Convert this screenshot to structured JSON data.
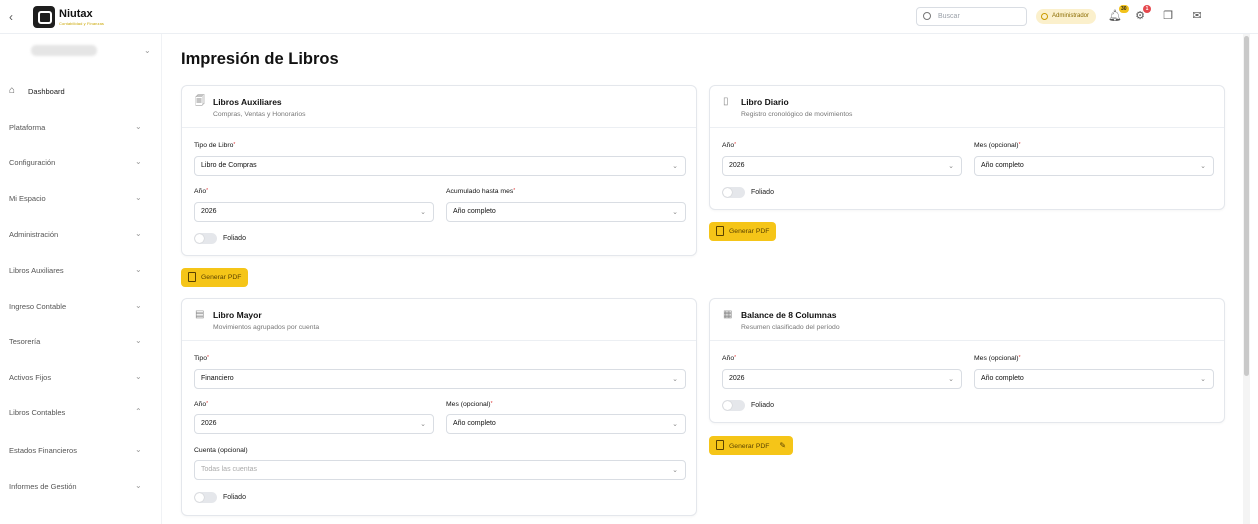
{
  "topbar": {
    "back_icon": "chevron-left-icon",
    "brand_name": "Niutax",
    "brand_tagline": "Contabilidad y Finanzas",
    "search_placeholder": "Buscar",
    "role_badge": "Administrador",
    "notifications_count": "30",
    "settings_count": "1"
  },
  "sidebar": {
    "dashboard": "Dashboard",
    "items": [
      {
        "label": "Plataforma",
        "open": false
      },
      {
        "label": "Configuración",
        "open": false
      },
      {
        "label": "Mi Espacio",
        "open": false
      },
      {
        "label": "Administración",
        "open": false
      },
      {
        "label": "Libros Auxiliares",
        "open": false
      },
      {
        "label": "Ingreso Contable",
        "open": false
      },
      {
        "label": "Tesorería",
        "open": false
      },
      {
        "label": "Activos Fijos",
        "open": false
      },
      {
        "label": "Libros Contables",
        "open": true
      },
      {
        "label": "Estados Financieros",
        "open": false
      },
      {
        "label": "Informes de Gestión",
        "open": false
      }
    ]
  },
  "page": {
    "title": "Impresión de Libros"
  },
  "cards": {
    "auxiliares": {
      "title": "Libros Auxiliares",
      "subtitle": "Compras, Ventas y Honorarios",
      "tipo_label": "Tipo de Libro",
      "tipo_value": "Libro de Compras",
      "anio_label": "Año",
      "anio_value": "2026",
      "mes_label": "Acumulado hasta mes",
      "mes_value": "Año completo",
      "foliado": "Foliado",
      "button": "Generar PDF"
    },
    "diario": {
      "title": "Libro Diario",
      "subtitle": "Registro cronológico de movimientos",
      "anio_label": "Año",
      "anio_value": "2026",
      "mes_label": "Mes (opcional)",
      "mes_value": "Año completo",
      "foliado": "Foliado",
      "button": "Generar PDF"
    },
    "mayor": {
      "title": "Libro Mayor",
      "subtitle": "Movimientos agrupados por cuenta",
      "tipo_label": "Tipo",
      "tipo_value": "Financiero",
      "anio_label": "Año",
      "anio_value": "2026",
      "mes_label": "Mes (opcional)",
      "mes_value": "Año completo",
      "cuenta_label": "Cuenta (opcional)",
      "cuenta_placeholder": "Todas las cuentas",
      "foliado": "Foliado"
    },
    "balance": {
      "title": "Balance de 8 Columnas",
      "subtitle": "Resumen clasificado del período",
      "anio_label": "Año",
      "anio_value": "2026",
      "mes_label": "Mes (opcional)",
      "mes_value": "Año completo",
      "foliado": "Foliado",
      "button": "Generar PDF"
    }
  },
  "colors": {
    "accent": "#f5c518",
    "required": "#dd3333"
  }
}
